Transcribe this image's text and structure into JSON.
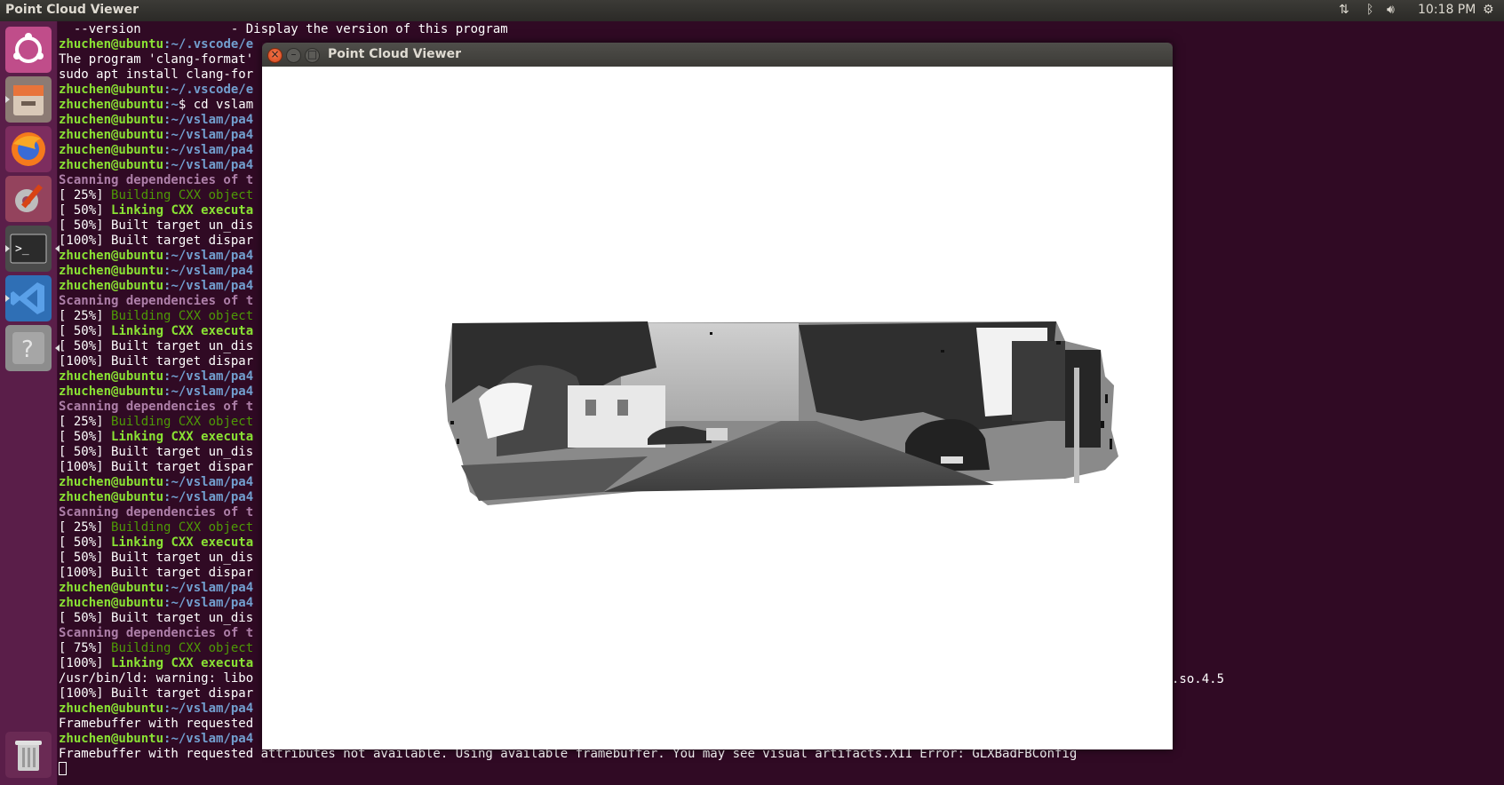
{
  "topbar": {
    "app_title": "Point Cloud Viewer",
    "clock": "10:18 PM",
    "network_icon": "network-updown-icon",
    "bluetooth_icon": "bluetooth-icon",
    "volume_icon": "volume-icon",
    "settings_icon": "gear-icon"
  },
  "launcher": {
    "items": [
      {
        "name": "ubuntu-dash"
      },
      {
        "name": "files"
      },
      {
        "name": "firefox"
      },
      {
        "name": "system-settings"
      },
      {
        "name": "terminal"
      },
      {
        "name": "vscode"
      },
      {
        "name": "help"
      },
      {
        "name": "trash"
      }
    ]
  },
  "terminal": {
    "lines": [
      [
        {
          "t": "  --version            - Display the version of this program",
          "c": ""
        }
      ],
      [
        {
          "t": "zhuchen@ubuntu",
          "c": "u"
        },
        {
          "t": ":~/.vscode/e",
          "c": "p"
        }
      ],
      [
        {
          "t": "The program 'clang-format'",
          "c": ""
        }
      ],
      [
        {
          "t": "sudo apt install clang-for",
          "c": ""
        }
      ],
      [
        {
          "t": "zhuchen@ubuntu",
          "c": "u"
        },
        {
          "t": ":~/.vscode/e",
          "c": "p"
        }
      ],
      [
        {
          "t": "zhuchen@ubuntu",
          "c": "u"
        },
        {
          "t": ":~",
          "c": "p"
        },
        {
          "t": "$ cd vslam",
          "c": ""
        }
      ],
      [
        {
          "t": "zhuchen@ubuntu",
          "c": "u"
        },
        {
          "t": ":~/vslam/pa4",
          "c": "p"
        }
      ],
      [
        {
          "t": "zhuchen@ubuntu",
          "c": "u"
        },
        {
          "t": ":~/vslam/pa4",
          "c": "p"
        }
      ],
      [
        {
          "t": "zhuchen@ubuntu",
          "c": "u"
        },
        {
          "t": ":~/vslam/pa4",
          "c": "p"
        }
      ],
      [
        {
          "t": "zhuchen@ubuntu",
          "c": "u"
        },
        {
          "t": ":~/vslam/pa4",
          "c": "p"
        }
      ],
      [
        {
          "t": "Scanning dependencies of t",
          "c": "scan"
        }
      ],
      [
        {
          "t": "[ 25%] ",
          "c": ""
        },
        {
          "t": "Building CXX object",
          "c": "bld"
        }
      ],
      [
        {
          "t": "[ 50%] ",
          "c": ""
        },
        {
          "t": "Linking CXX executa",
          "c": "lnk"
        }
      ],
      [
        {
          "t": "[ 50%] Built target un_dis",
          "c": ""
        }
      ],
      [
        {
          "t": "[100%] Built target dispar",
          "c": ""
        }
      ],
      [
        {
          "t": "zhuchen@ubuntu",
          "c": "u"
        },
        {
          "t": ":~/vslam/pa4",
          "c": "p"
        }
      ],
      [
        {
          "t": "zhuchen@ubuntu",
          "c": "u"
        },
        {
          "t": ":~/vslam/pa4",
          "c": "p"
        }
      ],
      [
        {
          "t": "zhuchen@ubuntu",
          "c": "u"
        },
        {
          "t": ":~/vslam/pa4",
          "c": "p"
        }
      ],
      [
        {
          "t": "Scanning dependencies of t",
          "c": "scan"
        }
      ],
      [
        {
          "t": "[ 25%] ",
          "c": ""
        },
        {
          "t": "Building CXX object",
          "c": "bld"
        }
      ],
      [
        {
          "t": "[ 50%] ",
          "c": ""
        },
        {
          "t": "Linking CXX executa",
          "c": "lnk"
        }
      ],
      [
        {
          "t": "[ 50%] Built target un_dis",
          "c": ""
        }
      ],
      [
        {
          "t": "[100%] Built target dispar",
          "c": ""
        }
      ],
      [
        {
          "t": "zhuchen@ubuntu",
          "c": "u"
        },
        {
          "t": ":~/vslam/pa4",
          "c": "p"
        }
      ],
      [
        {
          "t": "zhuchen@ubuntu",
          "c": "u"
        },
        {
          "t": ":~/vslam/pa4",
          "c": "p"
        }
      ],
      [
        {
          "t": "Scanning dependencies of t",
          "c": "scan"
        }
      ],
      [
        {
          "t": "[ 25%] ",
          "c": ""
        },
        {
          "t": "Building CXX object",
          "c": "bld"
        }
      ],
      [
        {
          "t": "[ 50%] ",
          "c": ""
        },
        {
          "t": "Linking CXX executa",
          "c": "lnk"
        }
      ],
      [
        {
          "t": "[ 50%] Built target un_dis",
          "c": ""
        }
      ],
      [
        {
          "t": "[100%] Built target dispar",
          "c": ""
        }
      ],
      [
        {
          "t": "zhuchen@ubuntu",
          "c": "u"
        },
        {
          "t": ":~/vslam/pa4",
          "c": "p"
        }
      ],
      [
        {
          "t": "zhuchen@ubuntu",
          "c": "u"
        },
        {
          "t": ":~/vslam/pa4",
          "c": "p"
        }
      ],
      [
        {
          "t": "Scanning dependencies of t",
          "c": "scan"
        }
      ],
      [
        {
          "t": "[ 25%] ",
          "c": ""
        },
        {
          "t": "Building CXX object",
          "c": "bld"
        }
      ],
      [
        {
          "t": "[ 50%] ",
          "c": ""
        },
        {
          "t": "Linking CXX executa",
          "c": "lnk"
        }
      ],
      [
        {
          "t": "[ 50%] Built target un_dis",
          "c": ""
        }
      ],
      [
        {
          "t": "[100%] Built target dispar",
          "c": ""
        }
      ],
      [
        {
          "t": "zhuchen@ubuntu",
          "c": "u"
        },
        {
          "t": ":~/vslam/pa4",
          "c": "p"
        }
      ],
      [
        {
          "t": "zhuchen@ubuntu",
          "c": "u"
        },
        {
          "t": ":~/vslam/pa4",
          "c": "p"
        }
      ],
      [
        {
          "t": "[ 50%] Built target un_dis",
          "c": ""
        }
      ],
      [
        {
          "t": "Scanning dependencies of t",
          "c": "scan"
        }
      ],
      [
        {
          "t": "[ 75%] ",
          "c": ""
        },
        {
          "t": "Building CXX object",
          "c": "bld"
        }
      ],
      [
        {
          "t": "[100%] ",
          "c": ""
        },
        {
          "t": "Linking CXX executa",
          "c": "lnk"
        }
      ],
      [
        {
          "t": "/usr/bin/ld: warning: libo",
          "c": ""
        }
      ],
      [
        {
          "t": "[100%] Built target dispar",
          "c": ""
        }
      ],
      [
        {
          "t": "zhuchen@ubuntu",
          "c": "u"
        },
        {
          "t": ":~/vslam/pa4",
          "c": "p"
        }
      ],
      [
        {
          "t": "Framebuffer with requested",
          "c": ""
        }
      ],
      [
        {
          "t": "zhuchen@ubuntu",
          "c": "u"
        },
        {
          "t": ":~/vslam/pa4",
          "c": "p"
        }
      ],
      [
        {
          "t": "Framebuffer with requested attributes not available. Using available framebuffer. You may see visual artifacts.X11 Error: GLXBadFBConfig",
          "c": ""
        }
      ]
    ],
    "tail_fragment": ".so.4.5"
  },
  "viewer": {
    "title": "Point Cloud Viewer",
    "close_icon": "close-icon",
    "minimize_icon": "minimize-icon",
    "maximize_icon": "maximize-icon"
  }
}
